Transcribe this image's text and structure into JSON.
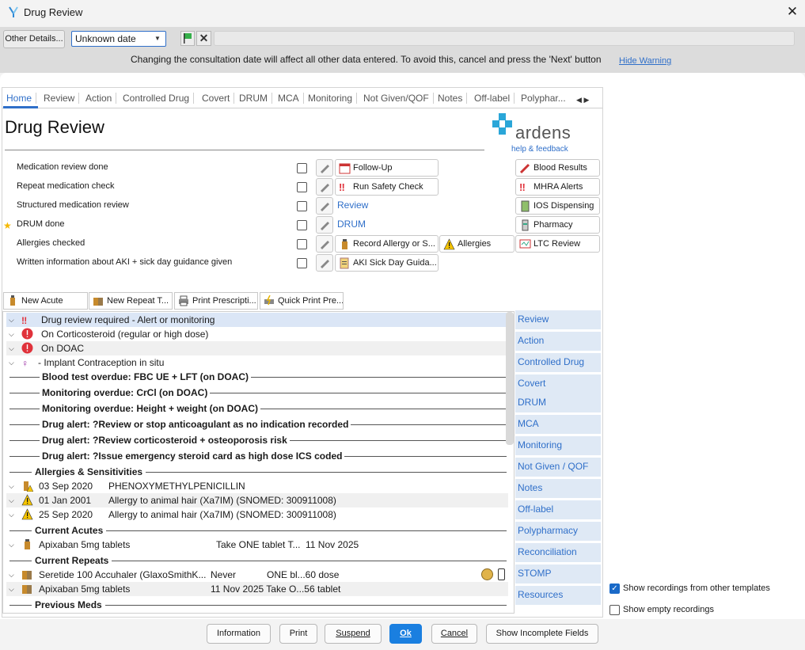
{
  "window": {
    "title": "Drug Review"
  },
  "datebar": {
    "other_details": "Other Details...",
    "date_value": "Unknown date",
    "warning": "Changing the consultation date will affect all other data entered. To avoid this, cancel and press the 'Next' button",
    "hide_warning": "Hide Warning"
  },
  "tabs": [
    "Home",
    "Review",
    "Action",
    "Controlled Drug",
    "Covert",
    "DRUM",
    "MCA",
    "Monitoring",
    "Not Given/QOF",
    "Notes",
    "Off-label",
    "Polyphar..."
  ],
  "page": {
    "title": "Drug Review",
    "logo": "ardens",
    "help": "help & feedback"
  },
  "checks": [
    {
      "label": "Medication review done"
    },
    {
      "label": "Repeat medication check"
    },
    {
      "label": "Structured medication review"
    },
    {
      "label": "DRUM done"
    },
    {
      "label": "Allergies checked"
    },
    {
      "label": "Written information about AKI + sick day guidance given"
    }
  ],
  "actions": {
    "follow_up": "Follow-Up",
    "run_safety": "Run Safety Check",
    "review": "Review",
    "drum": "DRUM",
    "record_allergy": "Record Allergy or S...",
    "allergies": "Allergies",
    "aki": "AKI Sick Day Guida...",
    "blood_results": "Blood Results",
    "mhra": "MHRA Alerts",
    "ios": "IOS Dispensing",
    "pharmacy": "Pharmacy",
    "ltc": "LTC Review"
  },
  "toolbar": {
    "new_acute": "New Acute",
    "new_repeat": "New Repeat T...",
    "print_rx": "Print Prescripti...",
    "quick_print": "Quick Print Pre..."
  },
  "list": {
    "r1": "Drug review required - Alert or monitoring",
    "r2": "On Corticosteroid (regular or high dose)",
    "r3": "On DOAC",
    "r4": "-    Implant Contraception in situ",
    "a1": "Blood test overdue: FBC UE + LFT (on DOAC)",
    "a2": "Monitoring overdue: CrCl (on DOAC)",
    "a3": "Monitoring overdue: Height + weight (on DOAC)",
    "a4": "Drug alert: ?Review or stop anticoagulant as no indication recorded",
    "a5": "Drug alert: ?Review corticosteroid + osteoporosis risk",
    "a6": "Drug alert: ?Issue emergency steroid card as high dose ICS coded",
    "s_allergies": "Allergies & Sensitivities",
    "al1_date": "03 Sep 2020",
    "al1_text": "PHENOXYMETHYLPENICILLIN",
    "al2_date": "01 Jan 2001",
    "al2_text": "Allergy to animal hair (Xa7IM) (SNOMED: 300911008)",
    "al3_date": "25 Sep 2020",
    "al3_text": "Allergy to animal hair (Xa7IM) (SNOMED: 300911008)",
    "s_acutes": "Current Acutes",
    "ac1_name": "Apixaban 5mg tablets",
    "ac1_dose": "Take ONE tablet T...",
    "ac1_date": "11 Nov 2025",
    "s_repeats": "Current Repeats",
    "rp1_name": "Seretide 100 Accuhaler (GlaxoSmithK...",
    "rp1_last": "Never",
    "rp1_dose": "ONE bl...60 dose",
    "rp2_name": "Apixaban 5mg tablets",
    "rp2_detail": "11 Nov 2025 Take O...56 tablet",
    "s_previous": "Previous Meds"
  },
  "sidenav": [
    "Review",
    "Action",
    "Controlled Drug",
    "Covert",
    "DRUM",
    "MCA",
    "Monitoring",
    "Not Given / QOF",
    "Notes",
    "Off-label",
    "Polypharmacy",
    "Reconciliation",
    "STOMP",
    "Resources"
  ],
  "options": {
    "show_other": "Show recordings from other templates",
    "show_other_checked": true,
    "show_empty": "Show empty recordings",
    "show_empty_checked": false
  },
  "buttons": {
    "information": "Information",
    "print": "Print",
    "suspend": "Suspend",
    "ok": "Ok",
    "cancel": "Cancel",
    "incomplete": "Show Incomplete Fields"
  },
  "colors": {
    "accent": "#2f6fc9",
    "alert": "#e0323b",
    "warn": "#f5c400"
  }
}
